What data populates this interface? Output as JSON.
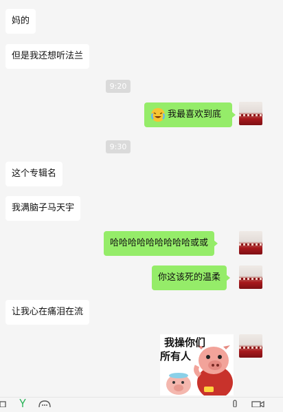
{
  "messages": [
    {
      "text": "妈的"
    },
    {
      "text": "但是我还想听法兰"
    },
    {
      "time": "9:20"
    },
    {
      "text": "我最喜欢到底"
    },
    {
      "time": "9:30"
    },
    {
      "text": "这个专辑名"
    },
    {
      "text": "我满脑子马天宇"
    },
    {
      "text": "哈哈哈哈哈哈哈哈哈或或"
    },
    {
      "text": "你这该死的温柔"
    },
    {
      "text": "让我心在痛泪在流"
    },
    {
      "sticker_line1": "我操你们",
      "sticker_line2": "所有人"
    }
  ],
  "icons": {
    "emoji_in_bubble": "cry-laugh-emoji-icon",
    "toolbar": [
      "folder-icon",
      "scissors-icon",
      "chat-history-icon",
      "mic-icon",
      "video-call-icon"
    ]
  },
  "colors": {
    "background": "#f5f5f5",
    "incoming_bubble": "#ffffff",
    "outgoing_bubble": "#95ec69",
    "timestamp_bg": "#dadada"
  }
}
